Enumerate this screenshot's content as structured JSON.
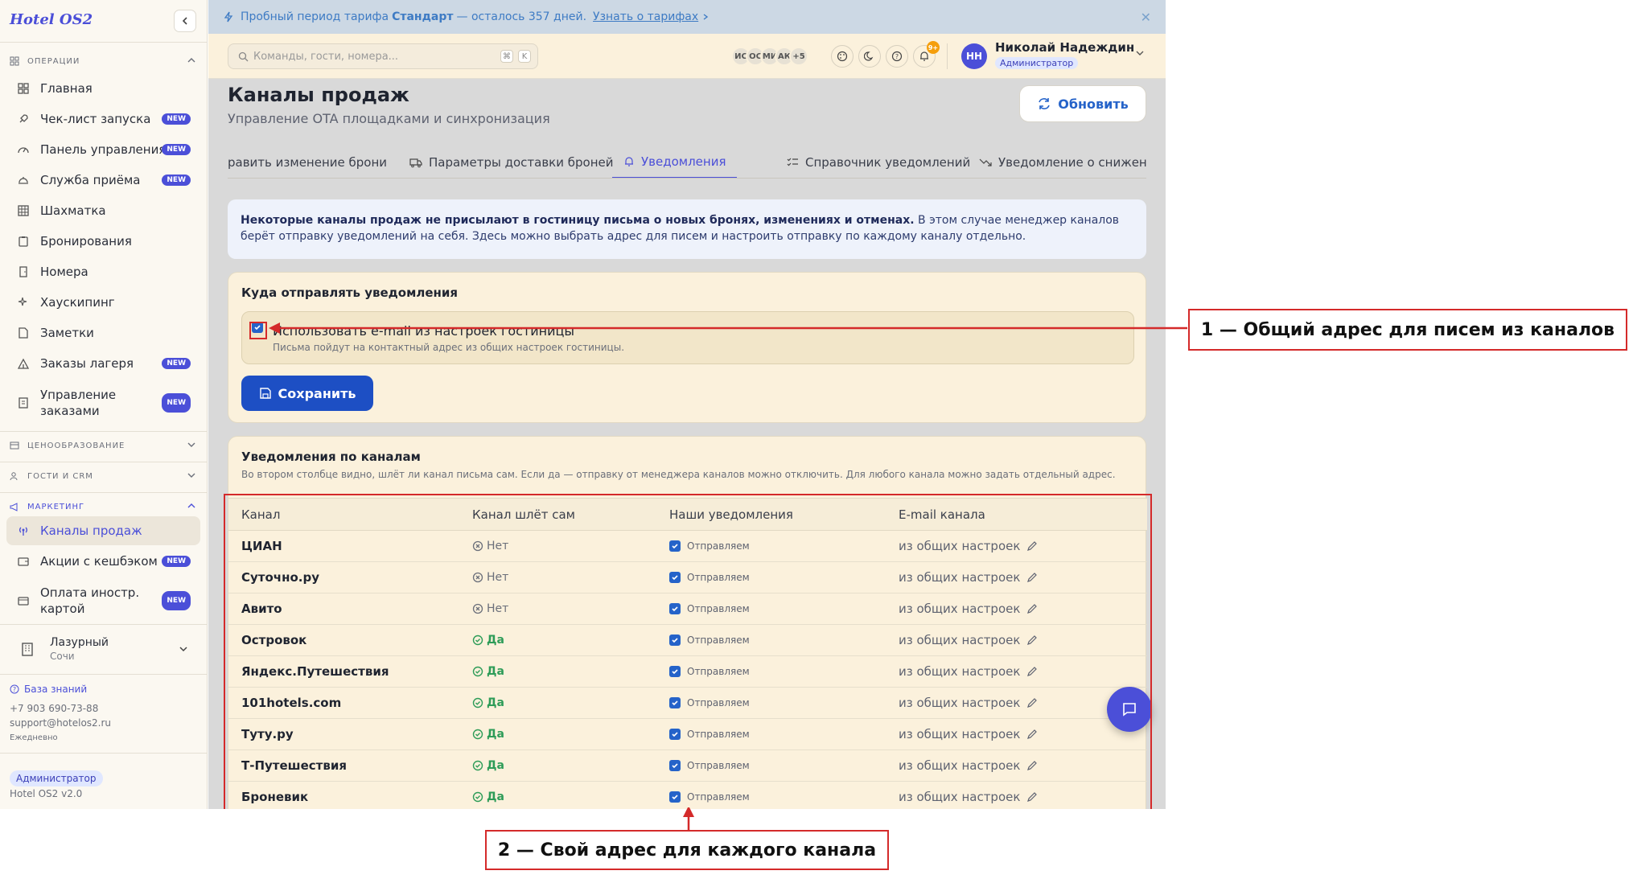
{
  "sidebar": {
    "brand": "Hotel OS2",
    "sections": {
      "operations": "ОПЕРАЦИИ",
      "pricing": "ЦЕНООБРАЗОВАНИЕ",
      "guests": "ГОСТИ И CRM",
      "marketing": "МАРКЕТИНГ"
    },
    "items": [
      {
        "label": "Главная",
        "icon": "grid-icon"
      },
      {
        "label": "Чек-лист запуска",
        "icon": "rocket-icon",
        "badge": "NEW"
      },
      {
        "label": "Панель управления",
        "icon": "gauge-icon",
        "badge": "NEW"
      },
      {
        "label": "Служба приёма",
        "icon": "bell-desk-icon",
        "badge": "NEW"
      },
      {
        "label": "Шахматка",
        "icon": "table-grid-icon"
      },
      {
        "label": "Бронирования",
        "icon": "clipboard-icon"
      },
      {
        "label": "Номера",
        "icon": "door-icon"
      },
      {
        "label": "Хаускипинг",
        "icon": "sparkles-icon"
      },
      {
        "label": "Заметки",
        "icon": "note-icon"
      },
      {
        "label": "Заказы лагеря",
        "icon": "tent-icon",
        "badge": "NEW"
      },
      {
        "label": "Управление заказами",
        "icon": "receipt-icon",
        "badge": "NEW"
      }
    ],
    "marketing_items": [
      {
        "label": "Каналы продаж",
        "icon": "broadcast-icon"
      },
      {
        "label": "Акции с кешбэком",
        "icon": "wallet-icon",
        "badge": "NEW"
      },
      {
        "label": "Оплата иностр. картой",
        "icon": "card-icon",
        "badge": "NEW"
      }
    ],
    "hotel": {
      "name": "Лазурный",
      "city": "Сочи"
    },
    "knowledge_base": "База знаний",
    "phone": "+7 903 690-73-88",
    "email": "support@hotelos2.ru",
    "schedule": "Ежедневно",
    "role": "Администратор",
    "version": "Hotel OS2 v2.0"
  },
  "banner": {
    "prefix": "Пробный период тарифа",
    "plan": "Стандарт",
    "suffix": "— осталось 357 дней.",
    "link": "Узнать о тарифах"
  },
  "topbar": {
    "search_placeholder": "Команды, гости, номера...",
    "kbd1": "⌘",
    "kbd2": "K",
    "avatars": [
      "ИС",
      "ОС",
      "МИ",
      "АК",
      "+5"
    ],
    "notif_count": "9+",
    "user_initials": "НН",
    "user_name": "Николай Надеждин",
    "user_role": "Администратор"
  },
  "page": {
    "title": "Каналы продаж",
    "subtitle": "Управление OTA площадками и синхронизация",
    "refresh": "Обновить",
    "tabs": [
      "равить изменение брони",
      "Параметры доставки броней",
      "Уведомления",
      "Справочник уведомлений",
      "Уведомление о снижении"
    ],
    "info_bold": "Некоторые каналы продаж не присылают в гостиницу письма о новых бронях, изменениях и отменах.",
    "info_rest": "В этом случае менеджер каналов берёт отправку уведомлений на себя. Здесь можно выбрать адрес для писем и настроить отправку по каждому каналу отдельно.",
    "where_title": "Куда отправлять уведомления",
    "use_hotel_email": "Использовать e-mail из настроек гостиницы",
    "use_hotel_email_hint": "Письма пойдут на контактный адрес из общих настроек гостиницы.",
    "save": "Сохранить",
    "channels_title": "Уведомления по каналам",
    "channels_desc": "Во втором столбце видно, шлёт ли канал письма сам. Если да — отправку от менеджера каналов можно отключить. Для любого канала можно задать отдельный адрес.",
    "columns": [
      "Канал",
      "Канал шлёт сам",
      "Наши уведомления",
      "E-mail канала"
    ],
    "rows": [
      {
        "channel": "ЦИАН",
        "self": "Нет",
        "ours": "Отправляем",
        "email": "из общих настроек"
      },
      {
        "channel": "Суточно.ру",
        "self": "Нет",
        "ours": "Отправляем",
        "email": "из общих настроек"
      },
      {
        "channel": "Авито",
        "self": "Нет",
        "ours": "Отправляем",
        "email": "из общих настроек"
      },
      {
        "channel": "Островок",
        "self": "Да",
        "ours": "Отправляем",
        "email": "из общих настроек"
      },
      {
        "channel": "Яндекс.Путешествия",
        "self": "Да",
        "ours": "Отправляем",
        "email": "из общих настроек"
      },
      {
        "channel": "101hotels.com",
        "self": "Да",
        "ours": "Отправляем",
        "email": "из общих настроек"
      },
      {
        "channel": "Туту.ру",
        "self": "Да",
        "ours": "Отправляем",
        "email": "из общих настроек"
      },
      {
        "channel": "Т-Путешествия",
        "self": "Да",
        "ours": "Отправляем",
        "email": "из общих настроек"
      },
      {
        "channel": "Броневик",
        "self": "Да",
        "ours": "Отправляем",
        "email": "из общих настроек"
      }
    ]
  },
  "annotations": {
    "callout1": "1 — Общий адрес для писем из каналов",
    "callout2": "2 — Свой адрес для каждого канала"
  },
  "colors": {
    "accent": "#4b4fd8",
    "annotation": "#d42a2a",
    "yes": "#2e9c58",
    "checkbox": "#2563c9"
  }
}
